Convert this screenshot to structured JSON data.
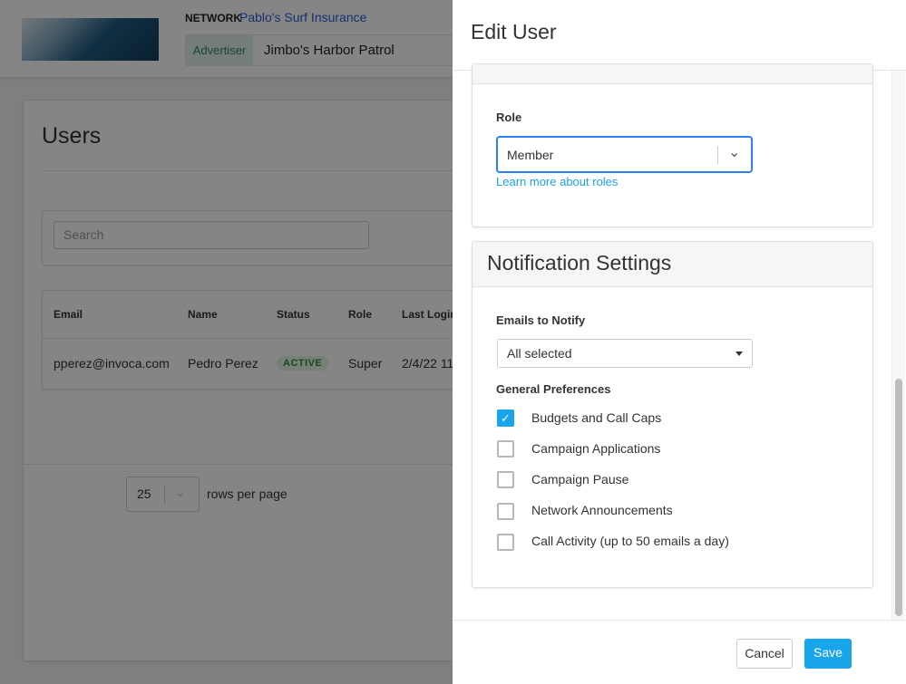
{
  "header": {
    "network_label": "NETWORK",
    "network_name": "Pablo's Surf Insurance",
    "advertiser_label": "Advertiser",
    "advertiser_name": "Jimbo's Harbor Patrol"
  },
  "users": {
    "title": "Users",
    "search_placeholder": "Search",
    "columns": [
      "Email",
      "Name",
      "Status",
      "Role",
      "Last Login"
    ],
    "rows": [
      {
        "email": "pperez@invoca.com",
        "name": "Pedro Perez",
        "status": "ACTIVE",
        "role": "Super",
        "last_login": "2/4/22 11"
      }
    ],
    "rows_per_page": "25",
    "rows_per_page_label": "rows per page"
  },
  "drawer": {
    "title": "Edit User",
    "role_label": "Role",
    "role_value": "Member",
    "role_link": "Learn more about roles",
    "notification_title": "Notification Settings",
    "emails_label": "Emails to Notify",
    "emails_value": "All selected",
    "prefs_label": "General Preferences",
    "prefs": [
      {
        "label": "Budgets and Call Caps",
        "checked": true
      },
      {
        "label": "Campaign Applications",
        "checked": false
      },
      {
        "label": "Campaign Pause",
        "checked": false
      },
      {
        "label": "Network Announcements",
        "checked": false
      },
      {
        "label": "Call Activity (up to 50 emails a day)",
        "checked": false
      }
    ],
    "cancel": "Cancel",
    "save": "Save"
  },
  "colors": {
    "accent": "#18a5ec",
    "focus": "#2d7ff9",
    "link": "#1aa3e8"
  }
}
